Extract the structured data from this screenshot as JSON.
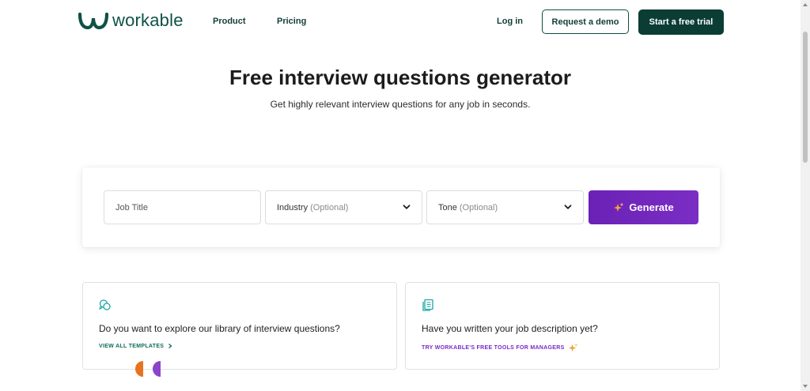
{
  "colors": {
    "brand_green": "#0b3d35",
    "generate_purple": "#6b21b6",
    "link_green": "#0f6b5c",
    "link_purple": "#7a28c8"
  },
  "header": {
    "logo_text": "workable",
    "nav": {
      "product": "Product",
      "pricing": "Pricing",
      "login": "Log in"
    },
    "demo_button": "Request a demo",
    "trial_button": "Start a free trial"
  },
  "hero": {
    "title": "Free interview questions generator",
    "subtitle": "Get highly relevant interview questions for any job in seconds."
  },
  "generator": {
    "job_title_placeholder": "Job Title",
    "industry_label": "Industry",
    "industry_optional": "(Optional)",
    "tone_label": "Tone",
    "tone_optional": "(Optional)",
    "generate_button": "Generate",
    "icons": {
      "dropdown": "chevron-down-icon",
      "generate": "sparkle-icon"
    }
  },
  "cards": [
    {
      "icon": "chat-bubbles-icon",
      "text": "Do you want to explore our library of interview questions?",
      "link": "VIEW ALL TEMPLATES"
    },
    {
      "icon": "document-icon",
      "text": "Have you written your job description yet?",
      "link": "TRY WORKABLE'S FREE TOOLS FOR MANAGERS"
    }
  ]
}
